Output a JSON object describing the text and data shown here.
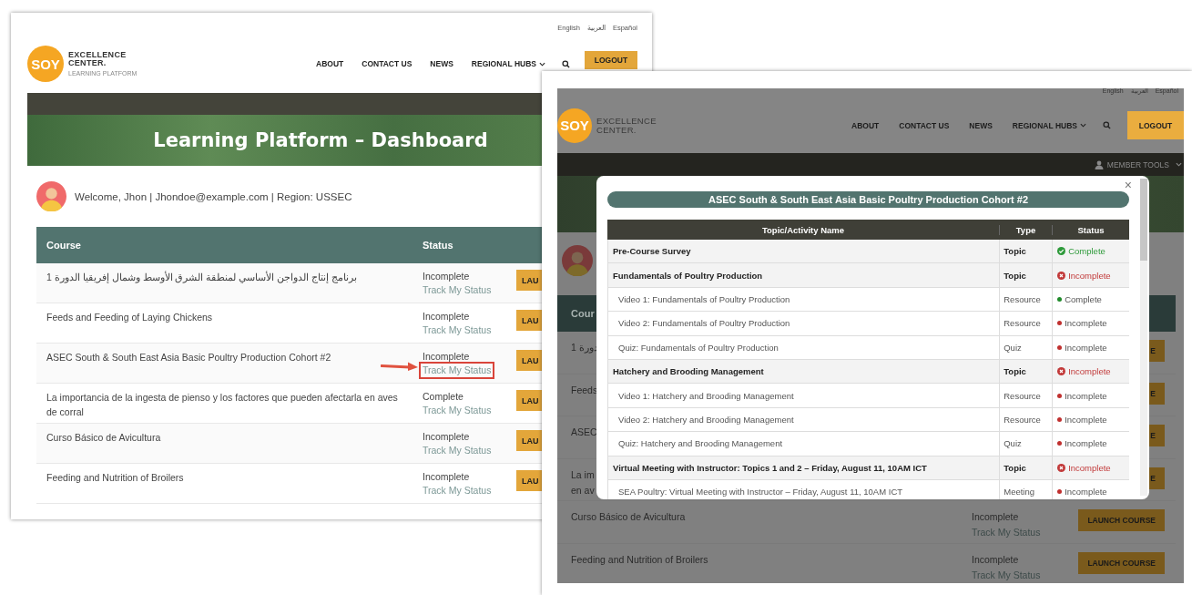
{
  "left_window": {
    "languages": [
      "English",
      "العربية",
      "Español"
    ],
    "logo": {
      "mark": "SOY",
      "line_1": "EXCELLENCE",
      "line_2": "CENTER.",
      "tagline": "LEARNING PLATFORM"
    },
    "nav": [
      {
        "label": "ABOUT",
        "dropdown": false
      },
      {
        "label": "CONTACT US",
        "dropdown": false
      },
      {
        "label": "NEWS",
        "dropdown": false
      },
      {
        "label": "REGIONAL HUBS",
        "dropdown": true
      }
    ],
    "logout": "LOGOUT",
    "hero_title": "Learning Platform – Dashboard",
    "welcome": "Welcome, Jhon | Jhondoe@example.com | Region: USSEC",
    "table": {
      "columns": [
        "Course",
        "Status"
      ],
      "rows": [
        {
          "course": "برنامج إنتاج الدواجن الأساسي لمنطقة الشرق الأوسط وشمال إفريقيا الدورة 1",
          "status": "Incomplete",
          "link": "Track My Status",
          "button": "LAU",
          "highlighted": false
        },
        {
          "course": "Feeds and Feeding of Laying Chickens",
          "status": "Incomplete",
          "link": "Track My Status",
          "button": "LAU",
          "highlighted": false
        },
        {
          "course": "ASEC South & South East Asia Basic Poultry Production Cohort #2",
          "status": "Incomplete",
          "link": "Track My Status",
          "button": "LAU",
          "highlighted": true
        },
        {
          "course": "La importancia de la ingesta de pienso y los factores que pueden afectarla en aves de corral",
          "status": "Complete",
          "link": "Track My Status",
          "button": "LAU",
          "highlighted": false
        },
        {
          "course": "Curso Básico de Avicultura",
          "status": "Incomplete",
          "link": "Track My Status",
          "button": "LAU",
          "highlighted": false
        },
        {
          "course": "Feeding and Nutrition of Broilers",
          "status": "Incomplete",
          "link": "Track My Status",
          "button": "LAU",
          "highlighted": false
        }
      ]
    }
  },
  "right_window": {
    "languages": [
      "English",
      "العربية",
      "Español"
    ],
    "logo": {
      "mark": "SOY",
      "line_1": "EXCELLENCE",
      "line_2": "CENTER."
    },
    "nav": [
      {
        "label": "ABOUT",
        "dropdown": false
      },
      {
        "label": "CONTACT US",
        "dropdown": false
      },
      {
        "label": "NEWS",
        "dropdown": false
      },
      {
        "label": "REGIONAL HUBS",
        "dropdown": true
      }
    ],
    "logout": "LOGOUT",
    "member_tools": "MEMBER TOOLS",
    "table": {
      "columns": [
        "Cour"
      ],
      "rows": [
        {
          "course": "دورة 1",
          "button": "E"
        },
        {
          "course": "Feeds",
          "button": "E"
        },
        {
          "course": "ASEC",
          "button": "E"
        },
        {
          "course": "La im",
          "course_line_2": "en av",
          "button": "E"
        },
        {
          "course": "Curso Básico de Avicultura",
          "status": "Incomplete",
          "link": "Track My Status",
          "button": "LAUNCH COURSE"
        },
        {
          "course": "Feeding and Nutrition of Broilers",
          "status": "Incomplete",
          "link": "Track My Status",
          "button": "LAUNCH COURSE"
        }
      ]
    },
    "modal": {
      "title": "ASEC South & South East Asia Basic Poultry Production Cohort #2",
      "close": "×",
      "columns": [
        "Topic/Activity Name",
        "Type",
        "Status"
      ],
      "rows": [
        {
          "kind": "topic",
          "name": "Pre-Course Survey",
          "type": "Topic",
          "status": "Complete",
          "complete": true
        },
        {
          "kind": "topic",
          "name": "Fundamentals of Poultry Production",
          "type": "Topic",
          "status": "Incomplete",
          "complete": false
        },
        {
          "kind": "item",
          "name": "Video 1: Fundamentals of Poultry Production",
          "type": "Resource",
          "status": "Complete",
          "complete": true
        },
        {
          "kind": "item",
          "name": "Video 2: Fundamentals of Poultry Production",
          "type": "Resource",
          "status": "Incomplete",
          "complete": false
        },
        {
          "kind": "item",
          "name": "Quiz: Fundamentals of Poultry Production",
          "type": "Quiz",
          "status": "Incomplete",
          "complete": false
        },
        {
          "kind": "topic",
          "name": "Hatchery and Brooding Management",
          "type": "Topic",
          "status": "Incomplete",
          "complete": false
        },
        {
          "kind": "item",
          "name": "Video 1: Hatchery and Brooding Management",
          "type": "Resource",
          "status": "Incomplete",
          "complete": false
        },
        {
          "kind": "item",
          "name": "Video 2: Hatchery and Brooding Management",
          "type": "Resource",
          "status": "Incomplete",
          "complete": false
        },
        {
          "kind": "item",
          "name": "Quiz: Hatchery and Brooding Management",
          "type": "Quiz",
          "status": "Incomplete",
          "complete": false
        },
        {
          "kind": "topic",
          "name": "Virtual Meeting with Instructor: Topics 1 and 2 – Friday, August 11, 10AM ICT",
          "type": "Topic",
          "status": "Incomplete",
          "complete": false
        },
        {
          "kind": "item",
          "name": "SEA Poultry: Virtual Meeting with Instructor – Friday, August 11, 10AM ICT",
          "type": "Meeting",
          "status": "Incomplete",
          "complete": false
        }
      ]
    }
  }
}
